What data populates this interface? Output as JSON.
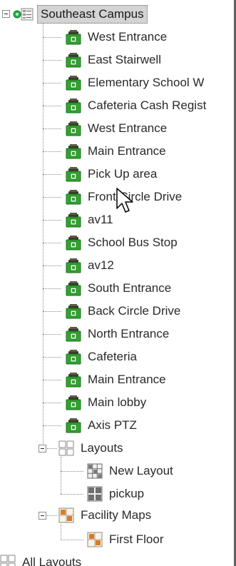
{
  "tree": {
    "root": {
      "label": "Southeast Campus",
      "icon": "network-root-icon"
    },
    "cameras": [
      {
        "label": "West Entrance",
        "icon": "camera-icon"
      },
      {
        "label": "East Stairwell",
        "icon": "camera-icon"
      },
      {
        "label": "Elementary School W",
        "icon": "camera-icon"
      },
      {
        "label": "Cafeteria Cash Regist",
        "icon": "camera-icon"
      },
      {
        "label": "West Entrance",
        "icon": "camera-icon"
      },
      {
        "label": "Main Entrance",
        "icon": "camera-icon"
      },
      {
        "label": "Pick Up area",
        "icon": "camera-icon"
      },
      {
        "label": "Front Circle Drive",
        "icon": "camera-icon"
      },
      {
        "label": "av11",
        "icon": "camera-icon"
      },
      {
        "label": "School Bus Stop",
        "icon": "camera-icon"
      },
      {
        "label": "av12",
        "icon": "camera-icon"
      },
      {
        "label": "South Entrance",
        "icon": "camera-icon"
      },
      {
        "label": "Back Circle Drive",
        "icon": "camera-icon"
      },
      {
        "label": "North Entrance",
        "icon": "camera-icon"
      },
      {
        "label": "Cafeteria",
        "icon": "camera-icon"
      },
      {
        "label": "Main Entrance",
        "icon": "camera-icon"
      },
      {
        "label": "Main lobby",
        "icon": "camera-icon"
      },
      {
        "label": "Axis PTZ",
        "icon": "camera-icon"
      }
    ],
    "layouts": {
      "label": "Layouts",
      "icon": "layouts-folder-icon",
      "items": [
        {
          "label": "New Layout",
          "icon": "grid-layout-icon"
        },
        {
          "label": "pickup",
          "icon": "quad-layout-icon"
        }
      ]
    },
    "facility_maps": {
      "label": "Facility Maps",
      "icon": "map-folder-icon",
      "items": [
        {
          "label": "First Floor",
          "icon": "floor-map-icon"
        }
      ]
    },
    "all_layouts": {
      "label": "All Layouts",
      "icon": "layouts-folder-icon"
    }
  },
  "colors": {
    "selection_bg": "#d4d4d4",
    "camera_green": "#2fa52f",
    "camera_body": "#3a3a2a",
    "map_orange": "#e07a1f",
    "status_green": "#22b14c"
  }
}
